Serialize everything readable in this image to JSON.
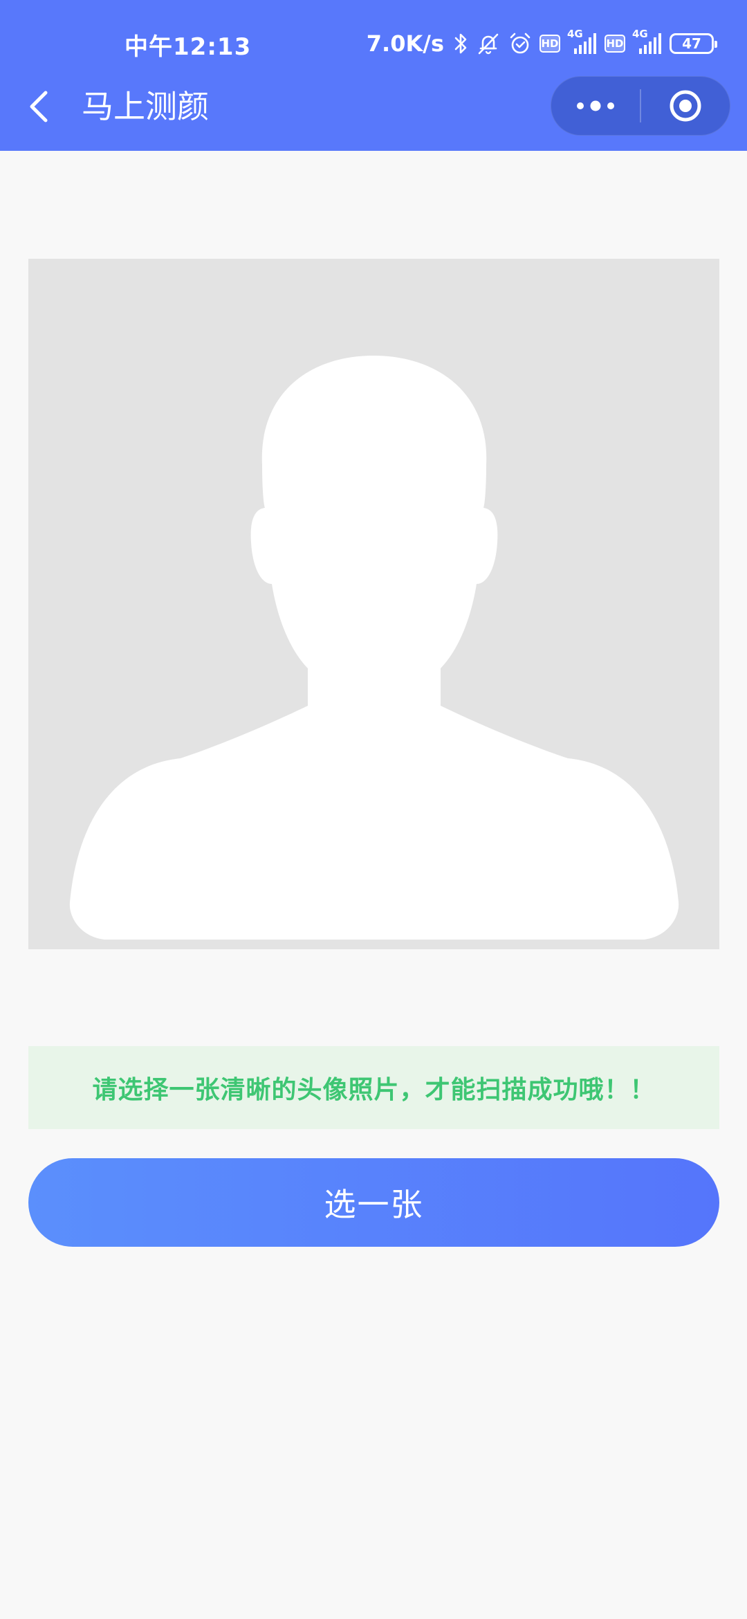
{
  "status_bar": {
    "time": "中午12:13",
    "net_speed": "7.0K/s",
    "hd1": "HD",
    "hd2": "HD",
    "signal1_label": "4G",
    "signal2_label": "4G",
    "battery": "47"
  },
  "nav": {
    "title": "马上测颜",
    "back_icon": "chevron-left-icon",
    "more_icon": "more-dots-icon",
    "close_icon": "target-circle-icon"
  },
  "avatar": {
    "icon": "person-silhouette-icon"
  },
  "tip": {
    "text": "请选择一张清晰的头像照片，才能扫描成功哦！！"
  },
  "actions": {
    "choose_label": "选一张"
  },
  "colors": {
    "primary": "#5878fb",
    "tip_green": "#3ec673",
    "tip_bg": "#e8f5e9",
    "placeholder_bg": "#e3e3e3"
  }
}
